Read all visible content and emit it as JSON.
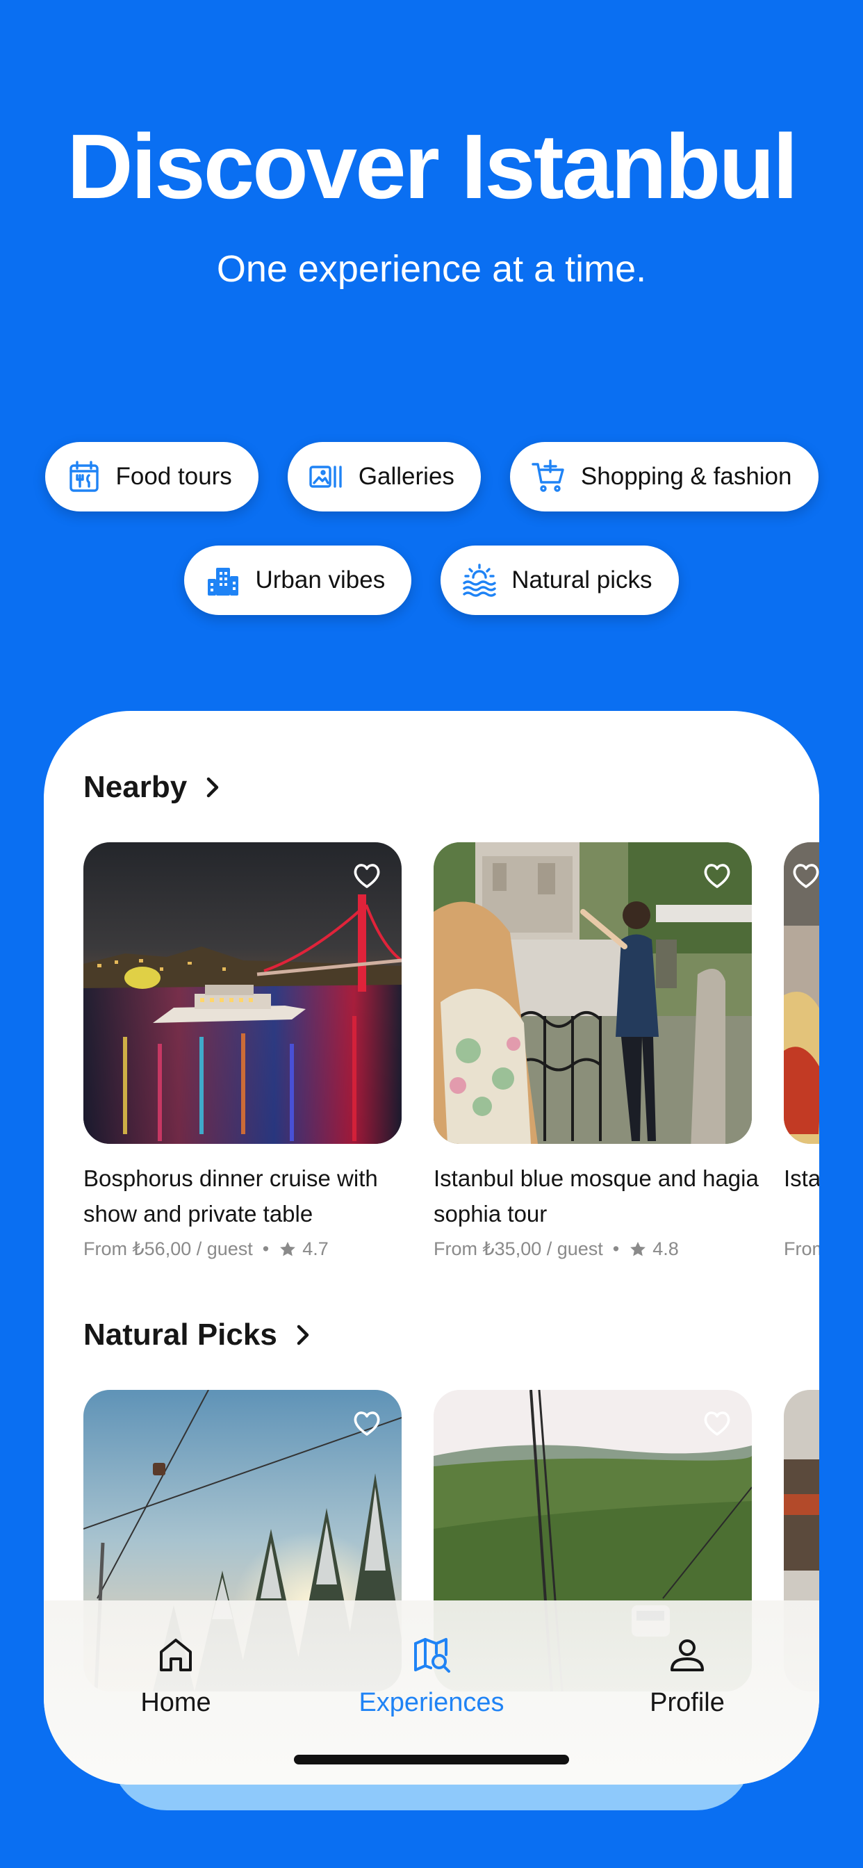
{
  "hero": {
    "title": "Discover Istanbul",
    "subtitle": "One experience at a time."
  },
  "categories": [
    {
      "label": "Food tours",
      "icon": "calendar-food-icon"
    },
    {
      "label": "Galleries",
      "icon": "gallery-icon"
    },
    {
      "label": "Shopping & fashion",
      "icon": "cart-add-icon"
    },
    {
      "label": "Urban vibes",
      "icon": "buildings-icon"
    },
    {
      "label": "Natural picks",
      "icon": "sun-waves-icon"
    }
  ],
  "nearby": {
    "title": "Nearby",
    "cards": [
      {
        "title": "Bosphorus dinner cruise with show and private table",
        "price": "From ₺56,00 / guest",
        "rating": "4.7"
      },
      {
        "title": "Istanbul blue mosque and hagia sophia tour",
        "price": "From ₺35,00 / guest",
        "rating": "4.8"
      },
      {
        "title": "Ista with",
        "price": "From"
      }
    ]
  },
  "natural_picks": {
    "title": "Natural Picks"
  },
  "tabs": [
    {
      "label": "Home",
      "icon": "home-icon",
      "active": false
    },
    {
      "label": "Experiences",
      "icon": "map-search-icon",
      "active": true
    },
    {
      "label": "Profile",
      "icon": "user-icon",
      "active": false
    }
  ],
  "colors": {
    "background": "#0a6ff2",
    "accent": "#1f83f5",
    "sheet": "#ffffff"
  }
}
